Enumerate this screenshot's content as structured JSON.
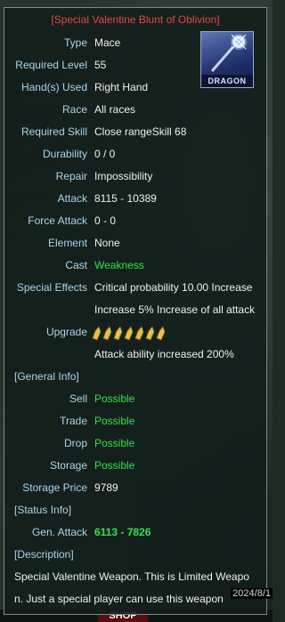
{
  "title": "[Special Valentine  Blunt of Oblivion]",
  "item_image": {
    "banner": "DRAGON",
    "icon": "mace-icon"
  },
  "props": [
    {
      "label": "Type",
      "value": "Mace"
    },
    {
      "label": "Required Level",
      "value": "55"
    },
    {
      "label": "Hand(s) Used",
      "value": "Right Hand"
    },
    {
      "label": "Race",
      "value": "All races"
    },
    {
      "label": "Required Skill",
      "value": "Close rangeSkill 68"
    },
    {
      "label": "Durability",
      "value": "0 / 0"
    },
    {
      "label": "Repair",
      "value": "Impossibility"
    },
    {
      "label": "Attack",
      "value": "8115 - 10389"
    },
    {
      "label": "Force Attack",
      "value": "0 - 0"
    },
    {
      "label": "Element",
      "value": "None"
    },
    {
      "label": "Cast",
      "value": "Weakness"
    },
    {
      "label": "Special Effects",
      "value": "Critical probability 10.00 Increase"
    }
  ],
  "special_extra": "Increase 5% Increase of all attack",
  "upgrade": {
    "label": "Upgrade",
    "level": 7,
    "note": "Attack ability increased 200%"
  },
  "general_info": {
    "header": "[General Info]",
    "rows": [
      {
        "label": "Sell",
        "value": "Possible"
      },
      {
        "label": "Trade",
        "value": "Possible"
      },
      {
        "label": "Drop",
        "value": "Possible"
      },
      {
        "label": "Storage",
        "value": "Possible"
      },
      {
        "label": "Storage Price",
        "value": "9789"
      }
    ]
  },
  "status_info": {
    "header": "[Status Info]",
    "rows": [
      {
        "label": "Gen. Attack",
        "value": "6113 - 7826"
      }
    ]
  },
  "description": {
    "header": "[Description]",
    "line1": "Special Valentine Weapon. This is Limited Weapo",
    "line2": "n. Just a special player can use this weapon"
  },
  "clock": "2024/8/1",
  "bottom_bar": {
    "shop_label": "SHOP"
  },
  "colors": {
    "title": "#e8483e",
    "label": "#a9d6f0",
    "value": "#f0f0f0",
    "positive": "#35e24a",
    "panel": "#121e1b"
  }
}
